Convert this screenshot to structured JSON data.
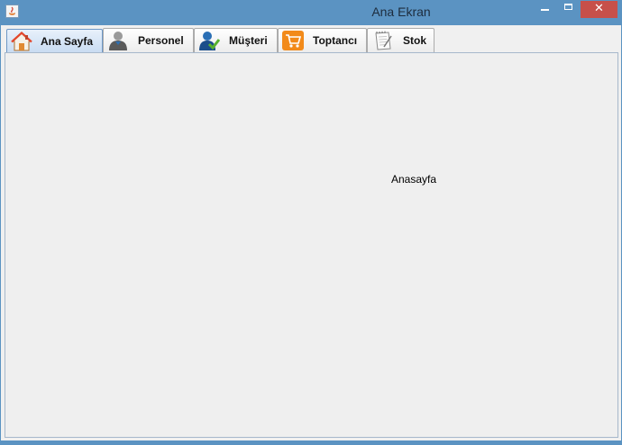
{
  "window": {
    "title": "Ana Ekran",
    "close_glyph": "✕",
    "accent_color": "#5b93c2",
    "close_color": "#c7504a"
  },
  "tabs": [
    {
      "label": "Ana Sayfa",
      "icon": "house-icon",
      "selected": true
    },
    {
      "label": "Personel",
      "icon": "person-icon",
      "selected": false
    },
    {
      "label": "Müşteri",
      "icon": "customer-check-icon",
      "selected": false
    },
    {
      "label": "Toptancı",
      "icon": "shopping-cart-icon",
      "selected": false
    },
    {
      "label": "Stok",
      "icon": "notepad-icon",
      "selected": false
    }
  ],
  "panel": {
    "label": "Anasayfa"
  }
}
